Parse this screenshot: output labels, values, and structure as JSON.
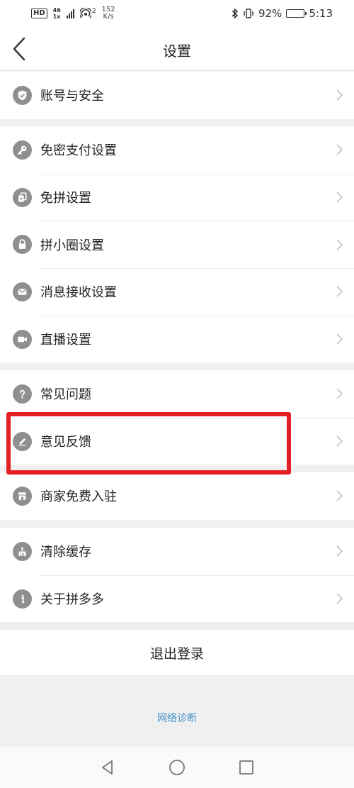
{
  "status_bar": {
    "hd": "HD",
    "network_top": "46",
    "network_bottom": "1x",
    "hotspot_count": "2",
    "speed_value": "152",
    "speed_unit": "K/s",
    "battery_percent": "92%",
    "battery_level": 0.92,
    "time": "5:13"
  },
  "header": {
    "title": "设置",
    "back_icon": "chevron-left-icon"
  },
  "groups": [
    {
      "items": [
        {
          "label": "账号与安全",
          "icon": "shield-check-icon"
        }
      ]
    },
    {
      "items": [
        {
          "label": "免密支付设置",
          "icon": "key-icon"
        },
        {
          "label": "免拼设置",
          "icon": "cards-icon"
        },
        {
          "label": "拼小圈设置",
          "icon": "lock-icon"
        },
        {
          "label": "消息接收设置",
          "icon": "mail-icon"
        },
        {
          "label": "直播设置",
          "icon": "video-camera-icon"
        }
      ]
    },
    {
      "items": [
        {
          "label": "常见问题",
          "icon": "question-icon"
        },
        {
          "label": "意见反馈",
          "icon": "pencil-icon"
        }
      ]
    },
    {
      "items": [
        {
          "label": "商家免费入驻",
          "icon": "store-icon"
        }
      ]
    },
    {
      "items": [
        {
          "label": "清除缓存",
          "icon": "broom-icon"
        },
        {
          "label": "关于拼多多",
          "icon": "info-icon"
        }
      ]
    }
  ],
  "logout_label": "退出登录",
  "network_diagnosis_label": "网络诊断",
  "colors": {
    "icon_bg": "#8f8f8f",
    "highlight_border": "#e41e25",
    "link": "#3d8fc9",
    "page_bg": "#f0f0f0"
  },
  "system_nav": [
    "back-triangle-icon",
    "home-circle-icon",
    "recents-square-icon"
  ]
}
